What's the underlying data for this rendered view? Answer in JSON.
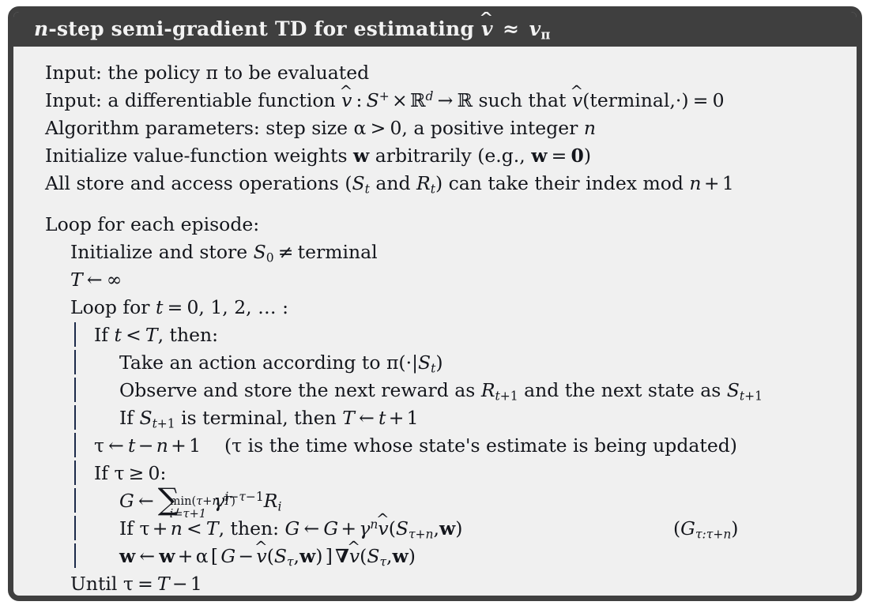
{
  "box": {
    "title_plain": "n-step semi-gradient TD for estimating v̂ ≈ vπ",
    "header_bg": "#3f3f3f",
    "header_fg": "#f2f2f2",
    "body_bg": "#f0f0f0",
    "body_fg": "#14161c",
    "rule_color": "#1c2a4a"
  },
  "title": {
    "n": "n",
    "rest": "-step semi-gradient TD for estimating",
    "vhat": "v",
    "approx": "≈",
    "v": "v",
    "pi": "π"
  },
  "preamble": [
    {
      "id": "input-policy",
      "text": "Input: the policy π to be evaluated"
    },
    {
      "id": "input-function",
      "text": "Input: a differentiable function v̂ : S+ × ℝd → ℝ such that v̂(terminal,·) = 0"
    },
    {
      "id": "algorithm-parameters",
      "text": "Algorithm parameters: step size α > 0, a positive integer n"
    },
    {
      "id": "initialize-weights",
      "text": "Initialize value-function weights w arbitrarily (e.g., w = 0)"
    },
    {
      "id": "index-mod",
      "text": "All store and access operations (St and Rt) can take their index mod n + 1"
    }
  ],
  "loop": [
    {
      "id": "loop-each-episode",
      "text": "Loop for each episode:"
    },
    {
      "id": "initialize-s0",
      "text": "Initialize and store S0 ≠ terminal"
    },
    {
      "id": "t-assign-infinity",
      "text": "T ← ∞"
    },
    {
      "id": "loop-for-t",
      "text": "Loop for t = 0, 1, 2, … :"
    },
    {
      "id": "if-t-lt-T",
      "text": "If t < T, then:"
    },
    {
      "id": "take-action",
      "text": "Take an action according to π(·|St)"
    },
    {
      "id": "observe-store",
      "text": "Observe and store the next reward as Rt+1 and the next state as St+1"
    },
    {
      "id": "if-terminal",
      "text": "If St+1 is terminal, then T ← t + 1"
    },
    {
      "id": "tau-assign",
      "text": "τ ← t − n + 1    (τ is the time whose state's estimate is being updated)"
    },
    {
      "id": "if-tau-ge-0",
      "text": "If τ ≥ 0:"
    },
    {
      "id": "g-assign-sum",
      "text": "G ← Σ i=τ+1 to min(τ+n,T) γ i−τ−1 Ri"
    },
    {
      "id": "if-tau-n-lt-T",
      "text": "If τ + n < T, then: G ← G + γn v̂(Sτ+n,w)"
    },
    {
      "id": "w-update",
      "text": "w ← w + α [G − v̂(Sτ,w)] ∇v̂(Sτ,w)"
    },
    {
      "id": "until-tau",
      "text": "Until τ = T − 1"
    }
  ],
  "annotations": {
    "g_return": "(Gτ:τ+n)"
  },
  "symbols": {
    "arrow_left": "←",
    "arrow_right": "→",
    "approx": "≈",
    "neq": "≠",
    "ge": "≥",
    "lt": "<",
    "gt": ">",
    "times": "×",
    "infinity": "∞",
    "sigma": "∑",
    "nabla": "∇",
    "cdot": "·",
    "mid": "|",
    "ellipsis": "…",
    "alpha": "α",
    "gamma": "γ",
    "tau": "τ",
    "pi": "π",
    "hat": "^"
  }
}
